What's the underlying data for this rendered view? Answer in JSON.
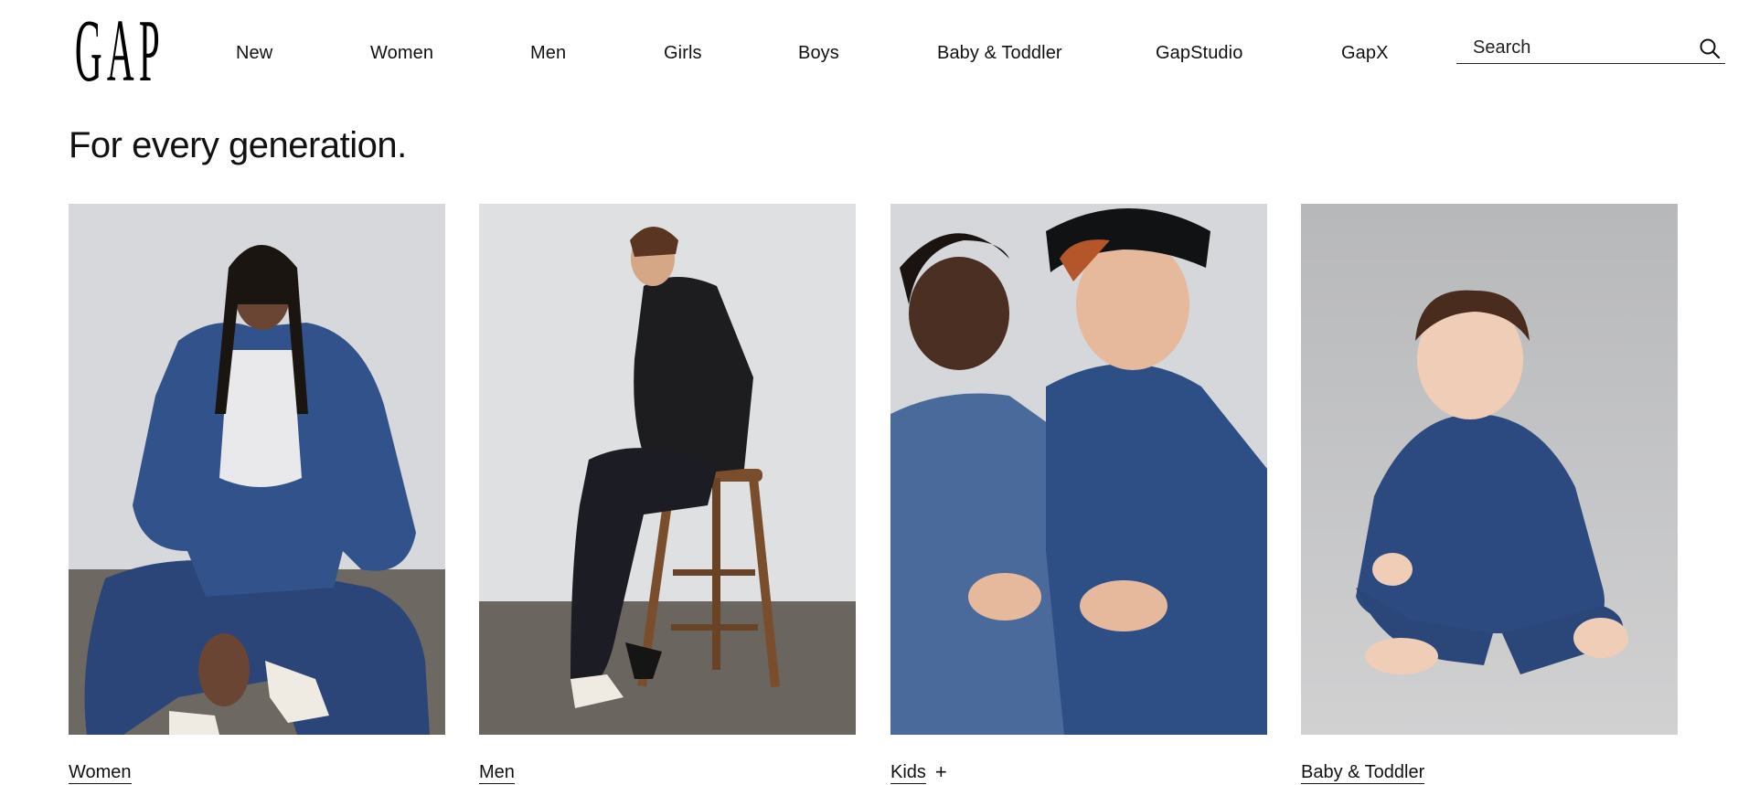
{
  "brand": {
    "logo_letters": [
      "G",
      "A",
      "P"
    ]
  },
  "nav": {
    "items": [
      {
        "label": "New"
      },
      {
        "label": "Women"
      },
      {
        "label": "Men"
      },
      {
        "label": "Girls"
      },
      {
        "label": "Boys"
      },
      {
        "label": "Baby & Toddler"
      },
      {
        "label": "GapStudio"
      },
      {
        "label": "GapX"
      }
    ]
  },
  "search": {
    "placeholder": "Search",
    "value": "",
    "icon": "search-icon"
  },
  "main": {
    "heading": "For every generation.",
    "cards": [
      {
        "label": "Women",
        "has_expand": false
      },
      {
        "label": "Men",
        "has_expand": false
      },
      {
        "label": "Kids",
        "has_expand": true,
        "expand_symbol": "+"
      },
      {
        "label": "Baby & Toddler",
        "has_expand": false
      }
    ]
  },
  "colors": {
    "text": "#111111",
    "denim": "#2f4d80",
    "backdrop": "#d9dadd",
    "floor": "#6b6560"
  }
}
